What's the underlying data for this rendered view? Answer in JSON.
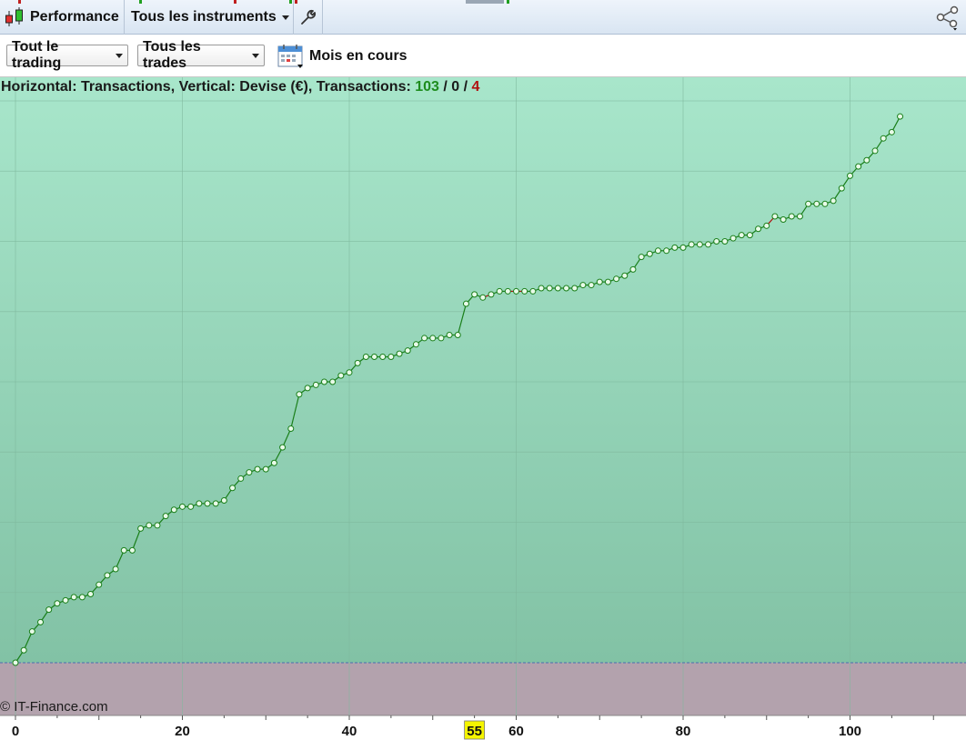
{
  "toolbar": {
    "performance_label": "Performance",
    "instruments_label": "Tous les instruments"
  },
  "filters": {
    "trading_label": "Tout le trading",
    "trades_label": "Tous les trades",
    "period_label": "Mois en cours"
  },
  "legend": {
    "text": "Horizontal: Transactions, Vertical: Devise (€), Transactions: ",
    "wins": "103",
    "sep1": " / ",
    "neutral": "0",
    "sep2": " / ",
    "losses": "4"
  },
  "copyright": "© IT-Finance.com",
  "colors": {
    "win": "#1e8c1e",
    "loss": "#b01010",
    "line": "#1a7f1a",
    "highlight": "#f5f500",
    "area_top": "#a8e6cb",
    "area_bottom": "#82c2a5",
    "negative_zone": "#b3a2ad"
  },
  "chart_data": {
    "type": "line",
    "title": "",
    "xlabel": "",
    "ylabel": "",
    "x_ticks": [
      "0",
      "20",
      "40",
      "60",
      "80",
      "100"
    ],
    "highlighted_x": "55",
    "xlim": [
      0,
      113
    ],
    "y_grid_lines": 8,
    "series": [
      {
        "values": [
          0,
          4,
          10,
          13,
          17,
          19,
          20,
          21,
          21,
          22,
          25,
          28,
          30,
          36,
          36,
          43,
          44,
          44,
          47,
          49,
          50,
          50,
          51,
          51,
          51,
          52,
          56,
          59,
          61,
          62,
          62,
          64,
          69,
          75,
          86,
          88,
          89,
          90,
          90,
          92,
          93,
          96,
          98,
          98,
          98,
          98,
          99,
          100,
          102,
          104,
          104,
          104,
          105,
          105,
          115,
          118,
          117,
          118,
          119,
          119,
          119,
          119,
          119,
          120,
          120,
          120,
          120,
          120,
          121,
          121,
          122,
          122,
          123,
          124,
          126,
          130,
          131,
          132,
          132,
          133,
          133,
          134,
          134,
          134,
          135,
          135,
          136,
          137,
          137,
          139,
          140,
          143,
          142,
          143,
          143,
          147,
          147,
          147,
          148,
          152,
          156,
          159,
          161,
          164,
          168,
          170,
          175
        ],
        "segment_colors": {
          "57": "loss",
          "60": "loss",
          "61": "loss",
          "91": "loss"
        }
      }
    ]
  }
}
